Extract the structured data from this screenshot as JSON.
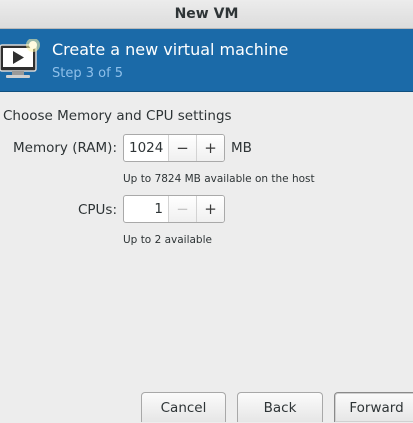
{
  "window": {
    "title": "New VM"
  },
  "banner": {
    "title": "Create a new virtual machine",
    "step": "Step 3 of 5",
    "icon": "vm-monitor-icon"
  },
  "main": {
    "heading": "Choose Memory and CPU settings",
    "memory": {
      "label": "Memory (RAM):",
      "value": "1024",
      "unit": "MB",
      "hint": "Up to 7824 MB available on the host",
      "decrement": "−",
      "increment": "+"
    },
    "cpus": {
      "label": "CPUs:",
      "value": "1",
      "hint": "Up to 2 available",
      "decrement": "−",
      "increment": "+"
    }
  },
  "buttons": {
    "cancel": "Cancel",
    "back": "Back",
    "forward": "Forward"
  },
  "colors": {
    "banner_bg": "#1b6aa8",
    "banner_step": "#8fc0ea",
    "window_bg": "#ededed"
  }
}
